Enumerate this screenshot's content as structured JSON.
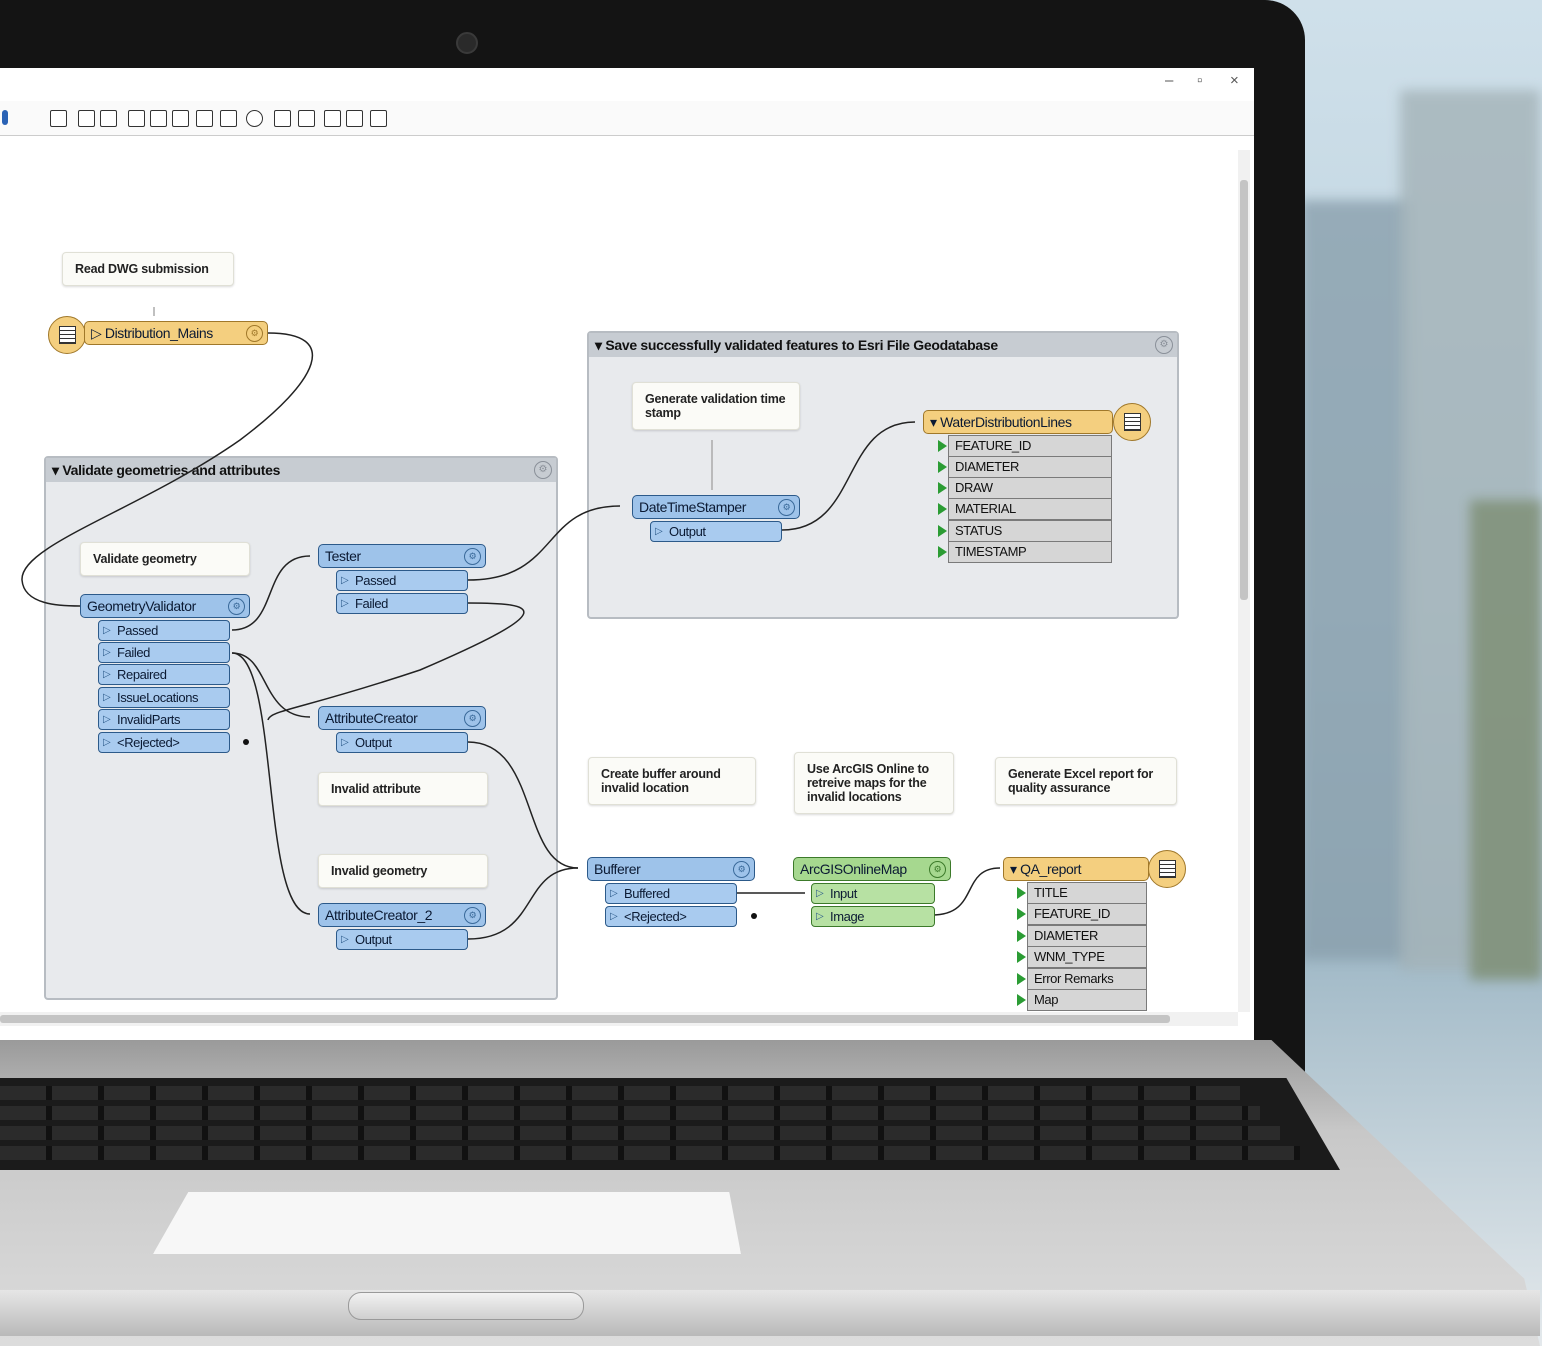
{
  "window": {
    "minimize": "–",
    "maximize": "▫",
    "close": "×"
  },
  "bookmarks": {
    "validate": "Validate geometries and attributes",
    "save": "Save successfully validated features to Esri File Geodatabase"
  },
  "notes": {
    "read_dwg": "Read DWG submission",
    "validate_geometry": "Validate geometry",
    "generate_timestamp": "Generate validation time stamp",
    "invalid_attribute": "Invalid attribute",
    "invalid_geometry": "Invalid geometry",
    "create_buffer": "Create buffer around invalid location",
    "use_arcgis": "Use ArcGIS Online to retreive maps for the invalid locations",
    "generate_excel": "Generate Excel report for quality assurance"
  },
  "reader": {
    "name": "Distribution_Mains"
  },
  "transformers": {
    "geometry_validator": {
      "name": "GeometryValidator",
      "ports": [
        "Passed",
        "Failed",
        "Repaired",
        "IssueLocations",
        "InvalidParts",
        "<Rejected>"
      ]
    },
    "tester": {
      "name": "Tester",
      "ports": [
        "Passed",
        "Failed"
      ]
    },
    "attribute_creator": {
      "name": "AttributeCreator",
      "ports": [
        "Output"
      ]
    },
    "attribute_creator_2": {
      "name": "AttributeCreator_2",
      "ports": [
        "Output"
      ]
    },
    "datetimestamper": {
      "name": "DateTimeStamper",
      "ports": [
        "Output"
      ]
    },
    "bufferer": {
      "name": "Bufferer",
      "ports": [
        "Buffered",
        "<Rejected>"
      ]
    },
    "arcgis": {
      "name": "ArcGISOnlineMap",
      "ports": [
        "Input",
        "Image"
      ]
    }
  },
  "writers": {
    "water": {
      "name": "WaterDistributionLines",
      "attrs": [
        "FEATURE_ID",
        "DIAMETER",
        "DRAW",
        "MATERIAL",
        "STATUS",
        "TIMESTAMP"
      ]
    },
    "qa": {
      "name": "QA_report",
      "attrs": [
        "TITLE",
        "FEATURE_ID",
        "DIAMETER",
        "WNM_TYPE",
        "Error Remarks",
        "Map"
      ]
    }
  },
  "colors": {
    "transformer": "#9ec3ea",
    "writer": "#f4cf7f",
    "online": "#a6d88f",
    "attribute_in": "#2b9c34"
  }
}
